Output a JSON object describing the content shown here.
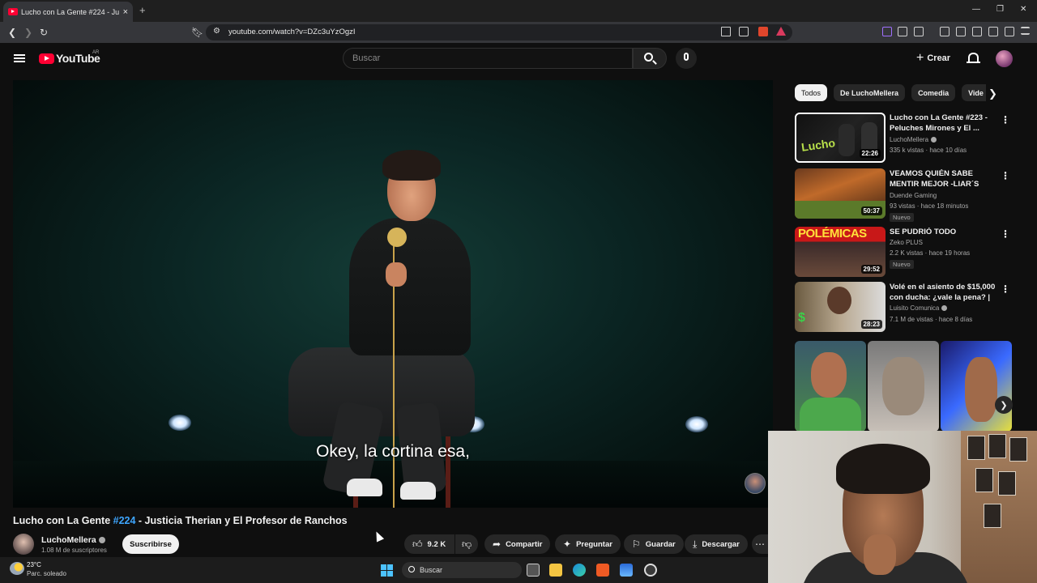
{
  "browser": {
    "tab_title": "Lucho con La Gente #224 - Ju",
    "url": "youtube.com/watch?v=DZc3uYzOgzI",
    "new_tab": "+",
    "tab_close": "×"
  },
  "header": {
    "logo_text": "YouTube",
    "country": "AR",
    "search_placeholder": "Buscar",
    "create_label": "Crear"
  },
  "player": {
    "subtitle": "Okey, la cortina esa,"
  },
  "video": {
    "title_prefix": "Lucho con La Gente ",
    "title_tag": "#224",
    "title_suffix": " - Justicia Therian y El Profesor de Ranchos",
    "channel_name": "LuchoMellera",
    "subscribers": "1.08 M de suscriptores",
    "subscribe_label": "Suscribirse",
    "likes": "9.2 K",
    "share_label": "Compartir",
    "ask_label": "Preguntar",
    "save_label": "Guardar",
    "download_label": "Descargar"
  },
  "chips": [
    "Todos",
    "De LuchoMellera",
    "Comedia",
    "Vide"
  ],
  "recommendations": [
    {
      "title": "Lucho con La Gente #223 - Peluches Mirones y El ...",
      "channel": "LuchoMellera",
      "verified": true,
      "meta": "335 k vistas · hace 10 días",
      "duration": "22:26",
      "badge": ""
    },
    {
      "title": "VEAMOS QUIÉN SABE MENTIR MEJOR -LIAR´S BA...",
      "channel": "Duende Gaming",
      "verified": false,
      "meta": "93 vistas · hace 18 minutos",
      "duration": "50:37",
      "badge": "Nuevo"
    },
    {
      "title": "SE PUDRIÓ TODO",
      "channel": "Zeko PLUS",
      "verified": false,
      "meta": "2.2 K vistas · hace 19 horas",
      "duration": "29:52",
      "badge": "Nuevo"
    },
    {
      "title": "Volé en el asiento de $15,000 con ducha: ¿vale la pena? | ...",
      "channel": "Luisito Comunica",
      "verified": true,
      "meta": "7.1 M de vistas · hace 8 días",
      "duration": "28:23",
      "badge": ""
    }
  ],
  "taskbar": {
    "temperature": "23°C",
    "weather": "Parc. soleado",
    "search_label": "Buscar"
  },
  "colors": {
    "youtube_red": "#ff0033",
    "link_blue": "#3ea6ff",
    "background": "#0f0f0f"
  }
}
